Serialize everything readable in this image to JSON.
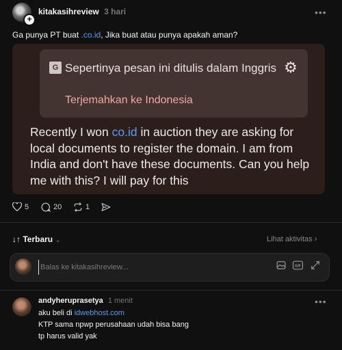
{
  "post": {
    "username": "kitakasihreview",
    "time": "3 hari",
    "more": "•••",
    "text_before": "Ga punya PT buat ",
    "text_link": ".co.id",
    "text_after": ", Jika buat atau punya apakah aman?"
  },
  "media": {
    "translate_title": "Sepertinya pesan ini ditulis dalam Inggris",
    "translate_action": "Terjemahkan ke Indonesia",
    "body_before": "Recently I won ",
    "body_link": "co.id",
    "body_after": " in auction they are asking for local documents to register the domain. I am from India and don't have these documents. Can you help me with this? I will pay for this"
  },
  "actions": {
    "likes": "5",
    "comments": "20",
    "reposts": "1"
  },
  "replies": {
    "sort_label": "Terbaru",
    "activity_label": "Lihat aktivitas",
    "input_placeholder": "Balas ke kitakasihreview..."
  },
  "comment": {
    "username": "andyheruprasetya",
    "time": "1 menit",
    "more": "•••",
    "line1_before": "aku beli di ",
    "line1_link": "idwebhost.com",
    "line2": "KTP sama npwp perusahaan udah bisa bang",
    "line3": "tp harus valid yak"
  },
  "colors": {
    "background": "#101010",
    "link": "#5a9cf0",
    "translate_action": "#f2a9a5"
  }
}
